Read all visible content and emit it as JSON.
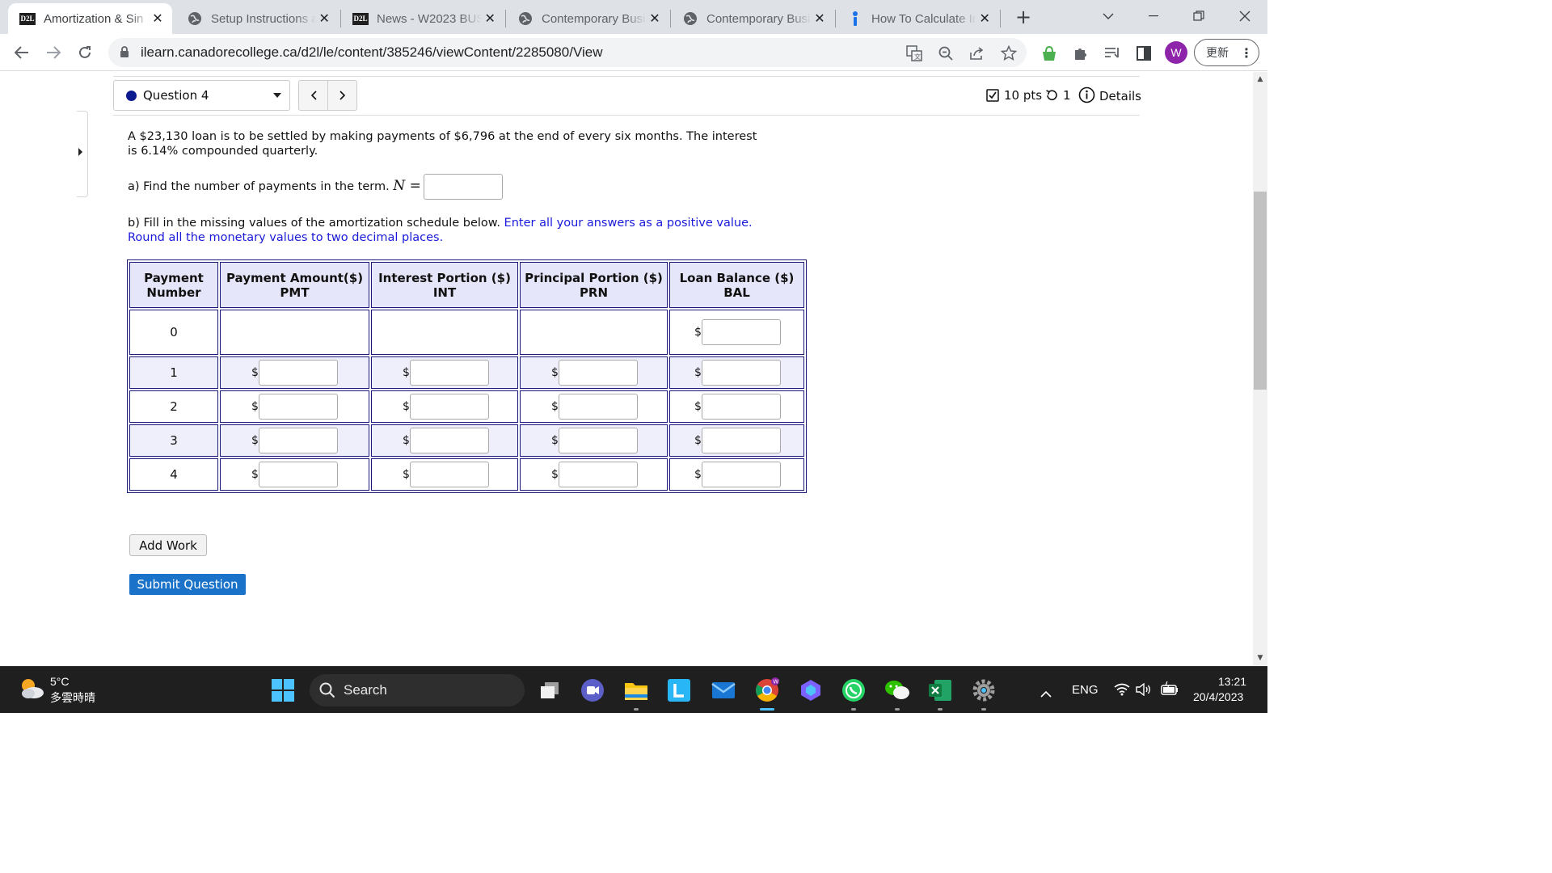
{
  "browser": {
    "tabs": [
      {
        "title": "Amortization & Sin",
        "favicon": "d2l-icon",
        "active": true
      },
      {
        "title": "Setup Instructions a",
        "favicon": "globe-icon",
        "active": false
      },
      {
        "title": "News - W2023 BUS",
        "favicon": "d2l-icon",
        "active": false
      },
      {
        "title": "Contemporary Busi",
        "favicon": "globe-icon",
        "active": false
      },
      {
        "title": "Contemporary Busi",
        "favicon": "globe-icon",
        "active": false
      },
      {
        "title": "How To Calculate In",
        "favicon": "info-icon",
        "active": false
      }
    ],
    "d2l_favicon_text": "D2L",
    "close_glyph": "✕",
    "new_tab_glyph": "+",
    "url": "ilearn.canadorecollege.ca/d2l/le/content/385246/viewContent/2285080/View",
    "profile_initial": "W",
    "update_label": "更新",
    "accent_color": "#8e24aa"
  },
  "question": {
    "selector_label": "Question 4",
    "prev_glyph": "<",
    "next_glyph": ">",
    "points": "10 pts",
    "attempts": "1",
    "details_label": "Details",
    "text_line1": "A $23,130 loan is to be settled by making payments of $6,796 at the end of every six months. The interest",
    "text_line2": "is 6.14% compounded quarterly.",
    "part_a": "a) Find the number of payments in the term.",
    "part_a_math": "N =",
    "part_b_black": "b) Fill in the missing values of the amortization schedule below.",
    "part_b_blue1": "Enter all your answers as a positive value.",
    "part_b_blue2": "Round all the monetary values to two decimal places."
  },
  "table": {
    "headers": [
      {
        "line1": "Payment",
        "line2": "Number"
      },
      {
        "line1": "Payment Amount($)",
        "line2": "PMT"
      },
      {
        "line1": "Interest Portion ($)",
        "line2": "INT"
      },
      {
        "line1": "Principal Portion ($)",
        "line2": "PRN"
      },
      {
        "line1": "Loan Balance ($)",
        "line2": "BAL"
      }
    ],
    "currency": "$",
    "rows": [
      "0",
      "1",
      "2",
      "3",
      "4"
    ]
  },
  "buttons": {
    "add_work": "Add Work",
    "submit": "Submit Question"
  },
  "taskbar": {
    "temperature": "5°C",
    "weather": "多雲時晴",
    "search_label": "Search",
    "language": "ENG",
    "time": "13:21",
    "date": "20/4/2023"
  }
}
